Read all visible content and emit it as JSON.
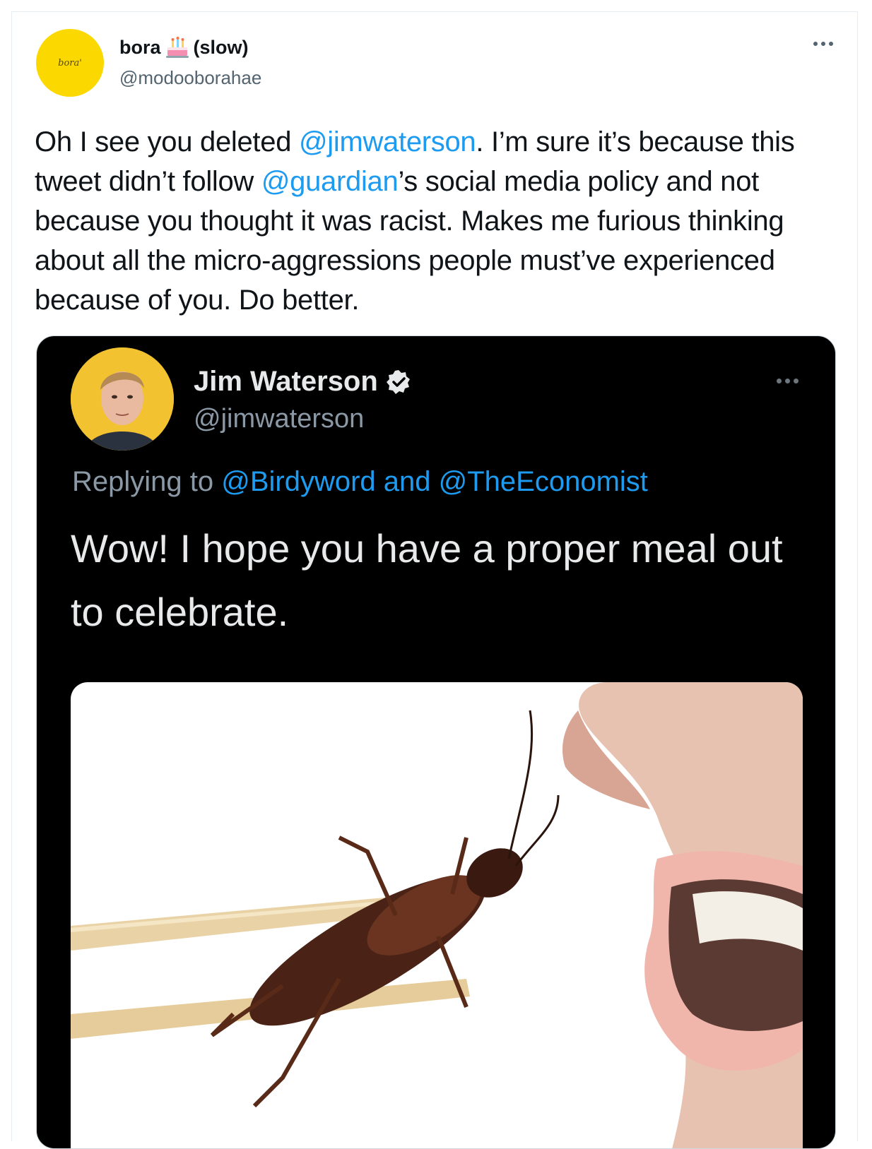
{
  "tweet": {
    "author_name": "bora",
    "author_suffix": "(slow)",
    "author_handle": "@modooborahae",
    "avatar_text": "bora'",
    "text_parts": [
      {
        "t": "Oh I see you deleted ",
        "m": false
      },
      {
        "t": "@jimwaterson",
        "m": true
      },
      {
        "t": ". I’m sure it’s because this tweet didn’t follow ",
        "m": false
      },
      {
        "t": "@guardian",
        "m": true
      },
      {
        "t": "’s social media policy and not because you thought it was racist. Makes me furious thinking about all the micro-aggressions people must’ve experienced because of you. Do better.",
        "m": false
      }
    ]
  },
  "embedded": {
    "author_name": "Jim Waterson",
    "author_handle": "@jimwaterson",
    "reply_prefix": "Replying to ",
    "reply_mention_1": "@Birdyword",
    "reply_and": " and ",
    "reply_mention_2": "@TheEconomist",
    "text": "Wow! I hope you have a proper meal out to celebrate."
  },
  "colors": {
    "accent": "#1d9bf0",
    "avatar_bg": "#fbd900",
    "embed_bg": "#000000"
  },
  "icons": [
    "birthday-cake-icon",
    "more-options-icon",
    "verified-badge-icon"
  ]
}
